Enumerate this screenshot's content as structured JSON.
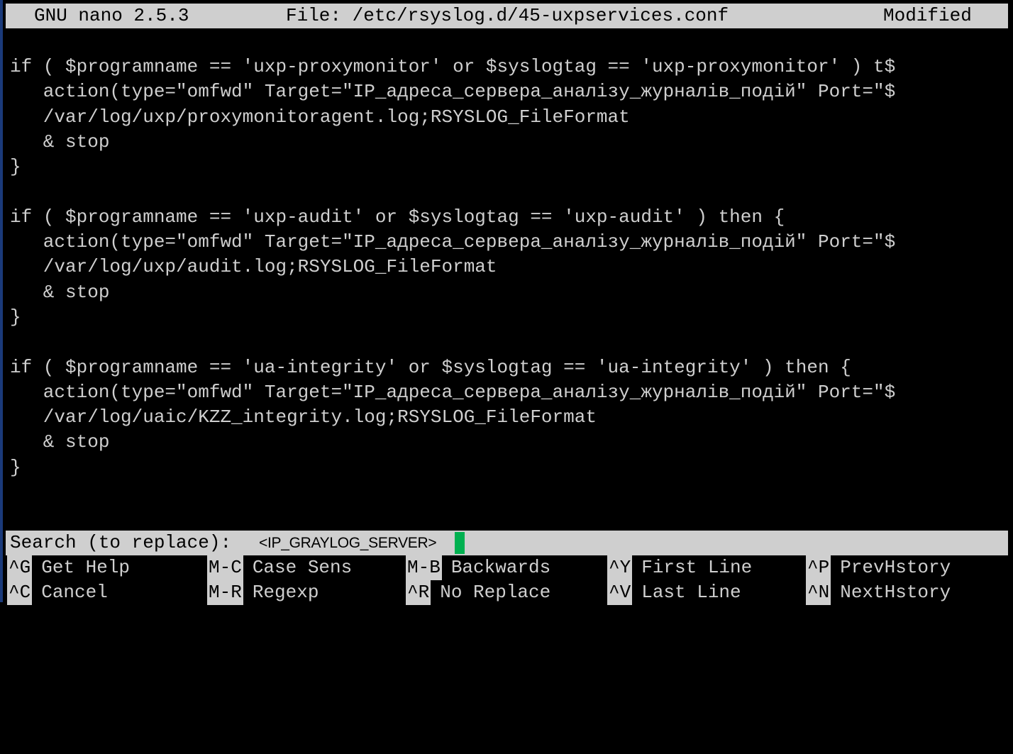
{
  "titlebar": {
    "app": "GNU nano 2.5.3",
    "file": "File: /etc/rsyslog.d/45-uxpservices.conf",
    "status": "Modified"
  },
  "editor": {
    "lines": [
      "if ( $programname == 'uxp-proxymonitor' or $syslogtag == 'uxp-proxymonitor' ) t$",
      "   action(type=\"omfwd\" Target=\"IP_адреса_сервера_аналізу_журналів_подій\" Port=\"$",
      "   /var/log/uxp/proxymonitoragent.log;RSYSLOG_FileFormat",
      "   & stop",
      "}",
      "",
      "if ( $programname == 'uxp-audit' or $syslogtag == 'uxp-audit' ) then {",
      "   action(type=\"omfwd\" Target=\"IP_адреса_сервера_аналізу_журналів_подій\" Port=\"$",
      "   /var/log/uxp/audit.log;RSYSLOG_FileFormat",
      "   & stop",
      "}",
      "",
      "if ( $programname == 'ua-integrity' or $syslogtag == 'ua-integrity' ) then {",
      "   action(type=\"omfwd\" Target=\"IP_адреса_сервера_аналізу_журналів_подій\" Port=\"$",
      "   /var/log/uaic/KZZ_integrity.log;RSYSLOG_FileFormat",
      "   & stop",
      "}",
      ""
    ]
  },
  "search": {
    "prompt": "Search (to replace):",
    "value": "<IP_GRAYLOG_SERVER>"
  },
  "shortcuts": {
    "row1": [
      {
        "key": "^G",
        "label": "Get Help"
      },
      {
        "key": "M-C",
        "label": "Case Sens"
      },
      {
        "key": "M-B",
        "label": "Backwards"
      },
      {
        "key": "^Y",
        "label": "First Line"
      },
      {
        "key": "^P",
        "label": "PrevHstory"
      }
    ],
    "row2": [
      {
        "key": "^C",
        "label": "Cancel"
      },
      {
        "key": "M-R",
        "label": "Regexp"
      },
      {
        "key": "^R",
        "label": "No Replace"
      },
      {
        "key": "^V",
        "label": "Last Line"
      },
      {
        "key": "^N",
        "label": "NextHstory"
      }
    ]
  },
  "colors": {
    "background": "#000000",
    "foreground": "#cfcfcf",
    "bar": "#cfcfcf",
    "cursor": "#00b050"
  }
}
